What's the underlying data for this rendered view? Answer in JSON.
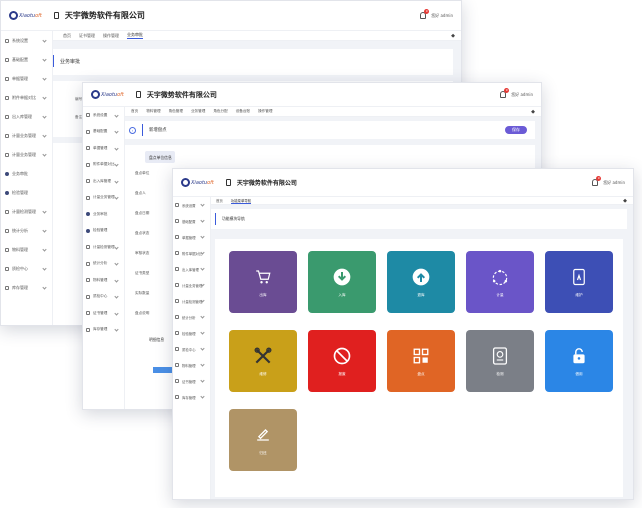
{
  "logo": {
    "text_main": "Xiaotu",
    "text_accent": "oft"
  },
  "company": "天宇微势软件有限公司",
  "user": {
    "name": "您好 admin",
    "notifications": "9"
  },
  "window1": {
    "tabs": [
      "首页",
      "证书管理",
      "操作管理",
      "业务审批"
    ],
    "page_title": "业务审批",
    "sidebar": [
      "系统设置",
      "基础配置",
      "单据管理",
      "附件单据对比",
      "出入库管理",
      "计量业务管理",
      "计量业务管理",
      "业务审批",
      "检验管理",
      "计量检测管理",
      "统计分析",
      "物料管理",
      "质检中心",
      "库存管理"
    ],
    "side_labels": [
      "编号",
      "备注"
    ]
  },
  "window2": {
    "tabs": [
      "首页",
      "物料管理",
      "角色管理",
      "业务管理",
      "角色分配",
      "设备台账",
      "操作管理"
    ],
    "page_title": "新增盘点",
    "add_button": "保存",
    "section_title": "盘点单位信息",
    "section2_title": "明细信息",
    "form_labels": [
      "盘点单位",
      "盘点人",
      "盘点日期",
      "盘点状态",
      "审核状态",
      "证书类型",
      "实际数量",
      "盘点说明"
    ],
    "sidebar": [
      "系统设置",
      "基础配置",
      "单据管理",
      "附件单据对比",
      "出入库管理",
      "计量业务管理",
      "业务审批",
      "检验管理",
      "计量检测管理",
      "统计分析",
      "物料管理",
      "质检中心",
      "证书管理",
      "库存管理"
    ]
  },
  "window3": {
    "tabs": [
      "首页",
      "功能菜单导航"
    ],
    "page_title": "功能模块导航",
    "sidebar": [
      "系统设置",
      "基础配置",
      "单据管理",
      "附件单据对比",
      "出入库管理",
      "计量业务管理",
      "计量检测管理",
      "统计分析",
      "检验管理",
      "质检中心",
      "物料管理",
      "证书管理",
      "库存管理"
    ],
    "tiles": [
      {
        "label": "出库",
        "color": "#6a4c93",
        "icon": "cart-icon"
      },
      {
        "label": "入库",
        "color": "#3a9a6e",
        "icon": "download-icon"
      },
      {
        "label": "退库",
        "color": "#1e8aa5",
        "icon": "upload-icon"
      },
      {
        "label": "计量",
        "color": "#6a55c8",
        "icon": "gauge-icon"
      },
      {
        "label": "维护",
        "color": "#3d4fb5",
        "icon": "touch-icon"
      },
      {
        "label": "维修",
        "color": "#c9a019",
        "icon": "tools-icon"
      },
      {
        "label": "报废",
        "color": "#e0201f",
        "icon": "forbidden-icon"
      },
      {
        "label": "盘点",
        "color": "#e06525",
        "icon": "grid-icon"
      },
      {
        "label": "检测",
        "color": "#7b7f87",
        "icon": "doc-icon"
      },
      {
        "label": "借用",
        "color": "#2b86e6",
        "icon": "lock-icon"
      },
      {
        "label": "归还",
        "color": "#b09466",
        "icon": "pen-icon"
      }
    ]
  }
}
